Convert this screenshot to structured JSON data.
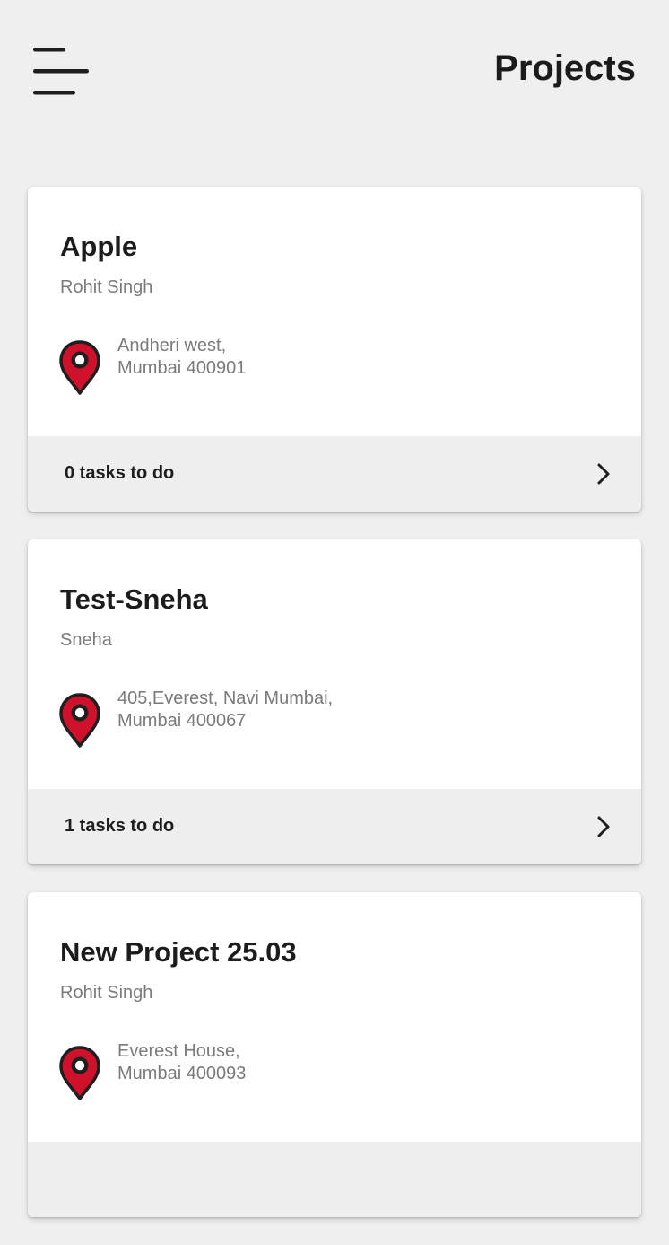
{
  "header": {
    "title": "Projects",
    "menu_icon": "hamburger-menu-icon"
  },
  "projects": [
    {
      "name": "Apple",
      "owner": "Rohit Singh",
      "address_line1": "Andheri west,",
      "address_line2": "Mumbai 400901",
      "tasks": "0 tasks to do"
    },
    {
      "name": "Test-Sneha",
      "owner": "Sneha",
      "address_line1": "405,Everest, Navi Mumbai,",
      "address_line2": "Mumbai 400067",
      "tasks": "1 tasks to do"
    },
    {
      "name": "New Project 25.03",
      "owner": "Rohit Singh",
      "address_line1": "Everest House,",
      "address_line2": "Mumbai 400093",
      "tasks": ""
    }
  ],
  "icons": {
    "location": "map-pin-icon",
    "chevron": "chevron-right-icon"
  },
  "colors": {
    "background": "#efefef",
    "card": "#ffffff",
    "card_footer": "#eeeeef",
    "pin_fill": "#d0112b",
    "pin_outline": "#1f1f1f",
    "secondary_text": "#7b7b7b"
  }
}
